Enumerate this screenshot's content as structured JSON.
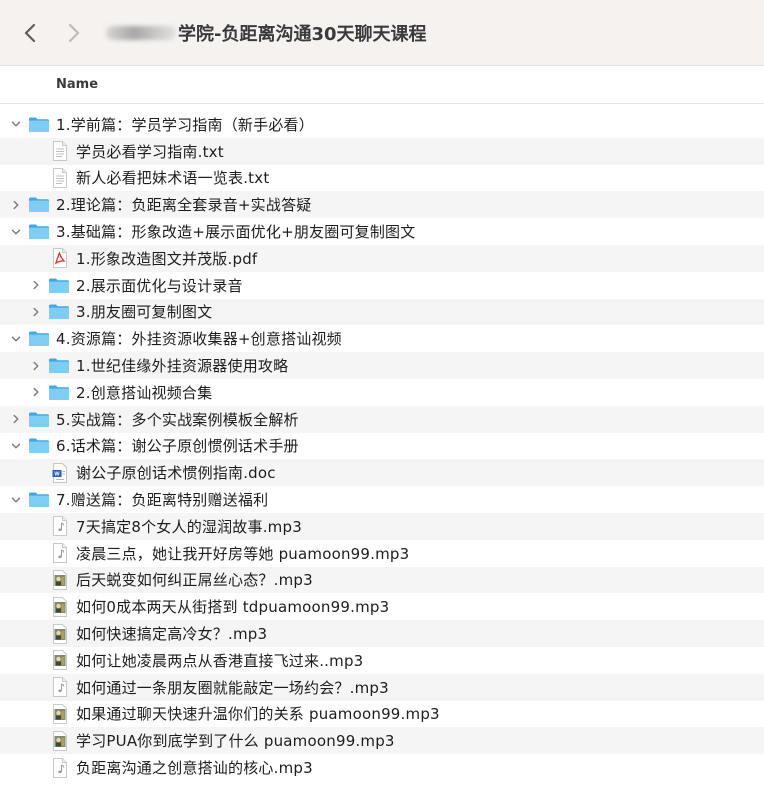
{
  "window": {
    "title": "学院-负距离沟通30天聊天课程",
    "column_header": "Name"
  },
  "rows": [
    {
      "label": "1.学前篇：学员学习指南（新手必看）",
      "depth": 0,
      "kind": "folder",
      "expanded": true
    },
    {
      "label": "学员必看学习指南.txt",
      "depth": 1,
      "kind": "txt"
    },
    {
      "label": "新人必看把妹术语一览表.txt",
      "depth": 1,
      "kind": "txt"
    },
    {
      "label": "2.理论篇：负距离全套录音+实战答疑",
      "depth": 0,
      "kind": "folder",
      "expanded": false
    },
    {
      "label": "3.基础篇：形象改造+展示面优化+朋友圈可复制图文",
      "depth": 0,
      "kind": "folder",
      "expanded": true
    },
    {
      "label": "1.形象改造图文并茂版.pdf",
      "depth": 1,
      "kind": "pdf"
    },
    {
      "label": "2.展示面优化与设计录音",
      "depth": 1,
      "kind": "folder",
      "expanded": false
    },
    {
      "label": "3.朋友圈可复制图文",
      "depth": 1,
      "kind": "folder",
      "expanded": false
    },
    {
      "label": "4.资源篇：外挂资源收集器+创意搭讪视频",
      "depth": 0,
      "kind": "folder",
      "expanded": true
    },
    {
      "label": "1.世纪佳缘外挂资源器使用攻略",
      "depth": 1,
      "kind": "folder",
      "expanded": false
    },
    {
      "label": "2.创意搭讪视频合集",
      "depth": 1,
      "kind": "folder",
      "expanded": false
    },
    {
      "label": "5.实战篇：多个实战案例模板全解析",
      "depth": 0,
      "kind": "folder",
      "expanded": false
    },
    {
      "label": "6.话术篇：谢公子原创惯例话术手册",
      "depth": 0,
      "kind": "folder",
      "expanded": true
    },
    {
      "label": "谢公子原创话术惯例指南.doc",
      "depth": 1,
      "kind": "doc"
    },
    {
      "label": "7.赠送篇：负距离特别赠送福利",
      "depth": 0,
      "kind": "folder",
      "expanded": true
    },
    {
      "label": "7天搞定8个女人的湿润故事.mp3",
      "depth": 1,
      "kind": "audio"
    },
    {
      "label": "凌晨三点，她让我开好房等她 puamoon99.mp3",
      "depth": 1,
      "kind": "audio"
    },
    {
      "label": "后天蜕变如何纠正屌丝心态？.mp3",
      "depth": 1,
      "kind": "audio-art"
    },
    {
      "label": "如何0成本两天从街搭到 tdpuamoon99.mp3",
      "depth": 1,
      "kind": "audio-art"
    },
    {
      "label": "如何快速搞定高冷女？.mp3",
      "depth": 1,
      "kind": "audio-art"
    },
    {
      "label": "如何让她凌晨两点从香港直接飞过来..mp3",
      "depth": 1,
      "kind": "audio-art"
    },
    {
      "label": "如何通过一条朋友圈就能敲定一场约会？.mp3",
      "depth": 1,
      "kind": "audio"
    },
    {
      "label": "如果通过聊天快速升温你们的关系 puamoon99.mp3",
      "depth": 1,
      "kind": "audio-art"
    },
    {
      "label": "学习PUA你到底学到了什么 puamoon99.mp3",
      "depth": 1,
      "kind": "audio-art"
    },
    {
      "label": "负距离沟通之创意搭讪的核心.mp3",
      "depth": 1,
      "kind": "audio"
    }
  ],
  "colors": {
    "folder_light": "#7fcdf3",
    "folder_dark": "#3ea9e6",
    "pdf_red": "#e3322b",
    "doc_blue": "#2b5fb8"
  }
}
